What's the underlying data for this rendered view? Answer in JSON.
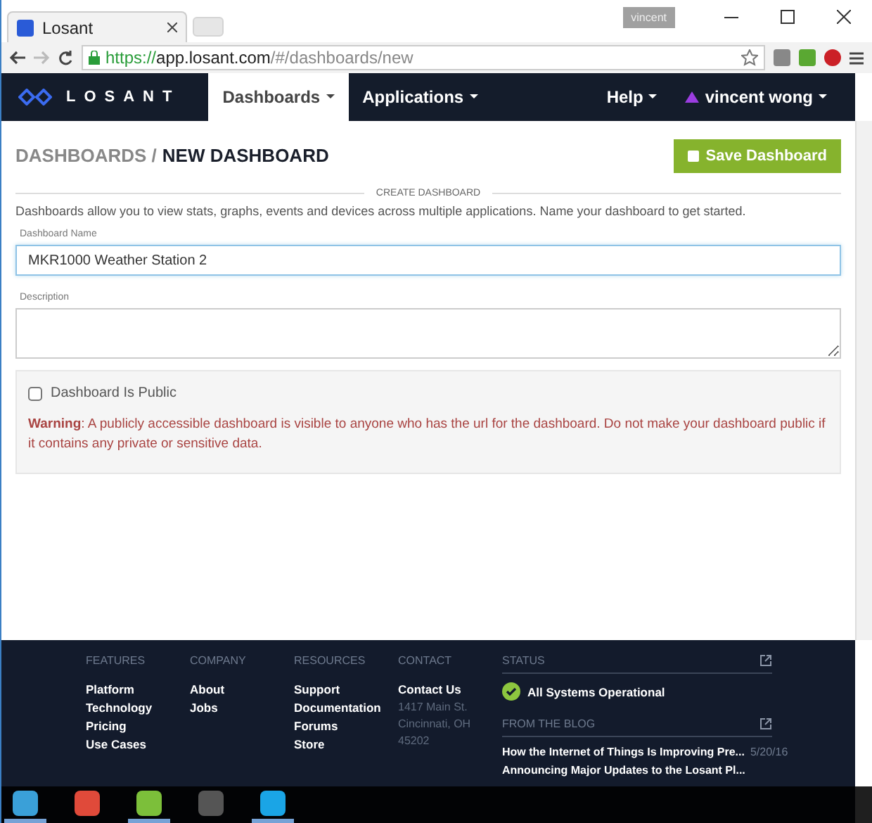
{
  "browser": {
    "tab_title": "Losant",
    "profile": "vincent",
    "url_secure": "https://",
    "url_host": "app.losant.com",
    "url_path": "/#/dashboards/new"
  },
  "nav": {
    "logo": "LOSANT",
    "items": [
      {
        "label": "Dashboards",
        "selected": true
      },
      {
        "label": "Applications",
        "selected": false
      }
    ],
    "help": "Help",
    "user": "vincent wong"
  },
  "page": {
    "breadcrumb": "DASHBOARDS /",
    "title": "NEW DASHBOARD",
    "save_button": "Save Dashboard",
    "section": "CREATE DASHBOARD",
    "intro": "Dashboards allow you to view stats, graphs, events and devices across multiple applications. Name your dashboard to get started.",
    "name_label": "Dashboard Name",
    "name_value": "MKR1000 Weather Station 2",
    "description_label": "Description",
    "public_label": "Dashboard Is Public",
    "public_checked": false,
    "warning": "**Warning**: A publicly accessible dashboard is visible to anyone who has the url for the dashboard. Do not make your dashboard public if it contains any private or sensitive data."
  },
  "footer": {
    "columns": [
      {
        "heading": "FEATURES",
        "links": [
          "Platform",
          "Technology",
          "Pricing",
          "Use Cases"
        ]
      },
      {
        "heading": "COMPANY",
        "links": [
          "About",
          "Jobs"
        ]
      },
      {
        "heading": "RESOURCES",
        "links": [
          "Support",
          "Documentation",
          "Forums",
          "Store"
        ]
      },
      {
        "heading": "CONTACT",
        "links": [
          "Contact Us"
        ],
        "address": [
          "1417 Main St.",
          "Cincinnati, OH",
          "45202"
        ]
      }
    ],
    "status_heading": "STATUS",
    "status": "All Systems Operational",
    "blog_heading": "FROM THE BLOG",
    "posts": [
      {
        "title": "How the Internet of Things Is Improving Pre...",
        "date": "5/20/16"
      },
      {
        "title": "Announcing Major Updates to the Losant Pl..."
      }
    ]
  },
  "taskbar": [
    {
      "color": "#3aa0d8",
      "selected": true
    },
    {
      "color": "#e04a3a",
      "selected": false
    },
    {
      "color": "#7cbf3a",
      "selected": true
    },
    {
      "color": "#555555",
      "selected": false
    },
    {
      "color": "#1aa5e6",
      "selected": true
    }
  ]
}
